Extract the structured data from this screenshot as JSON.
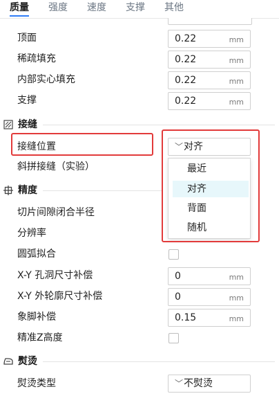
{
  "tabs": [
    {
      "label": "质量",
      "active": true
    },
    {
      "label": "强度",
      "active": false
    },
    {
      "label": "速度",
      "active": false
    },
    {
      "label": "支撑",
      "active": false
    },
    {
      "label": "其他",
      "active": false
    }
  ],
  "rows_top": [
    {
      "label": "顶面",
      "value": "0.22",
      "unit": "mm"
    },
    {
      "label": "稀疏填充",
      "value": "0.22",
      "unit": "mm"
    },
    {
      "label": "内部实心填充",
      "value": "0.22",
      "unit": "mm"
    },
    {
      "label": "支撑",
      "value": "0.22",
      "unit": "mm"
    }
  ],
  "seam": {
    "title": "接缝",
    "icon": "seam-icon",
    "position_label": "接缝位置",
    "position_value": "对齐",
    "scarf_label": "斜拼接缝（实验）",
    "options": [
      "最近",
      "对齐",
      "背面",
      "随机"
    ],
    "highlighted_option": "对齐"
  },
  "precision": {
    "title": "精度",
    "icon": "precision-icon",
    "rows": [
      {
        "label": "切片间隙闭合半径"
      },
      {
        "label": "分辨率"
      },
      {
        "label": "圆弧拟合"
      },
      {
        "label": "X-Y 孔洞尺寸补偿",
        "value": "0",
        "unit": "mm"
      },
      {
        "label": "X-Y 外轮廓尺寸补偿",
        "value": "0",
        "unit": "mm"
      },
      {
        "label": "象脚补偿",
        "value": "0.15",
        "unit": "mm"
      },
      {
        "label": "精准Z高度"
      }
    ]
  },
  "ironing": {
    "title": "熨烫",
    "icon": "ironing-icon",
    "type_label": "熨烫类型",
    "type_value": "不熨烫"
  },
  "colors": {
    "accent": "#2f7cf6",
    "highlight_box": "#e23a3a",
    "option_highlight_bg": "#e7f7fb"
  }
}
